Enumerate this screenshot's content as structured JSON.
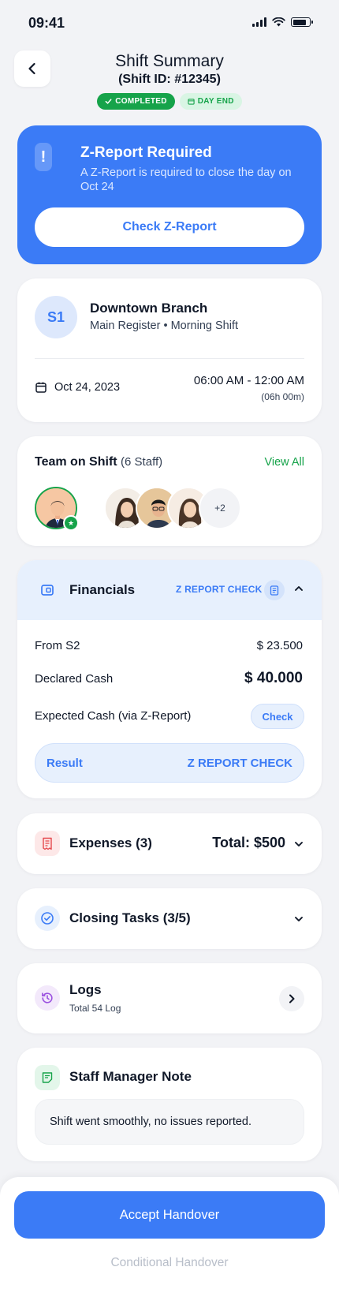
{
  "status_bar": {
    "time": "09:41"
  },
  "header": {
    "title": "Shift Summary",
    "subtitle": "(Shift ID: #12345)",
    "badge_completed": "COMPLETED",
    "badge_day_end": "DAY END"
  },
  "z_report_banner": {
    "title": "Z-Report Required",
    "description": "A Z-Report is required to close the day on Oct 24",
    "button_label": "Check Z-Report"
  },
  "branch": {
    "avatar_initials": "S1",
    "name": "Downtown Branch",
    "details": "Main Register • Morning Shift",
    "date": "Oct 24, 2023",
    "time_range": "06:00 AM - 12:00 AM",
    "duration": "(06h 00m)"
  },
  "team": {
    "title": "Team on Shift",
    "count": "(6 Staff)",
    "view_all": "View All",
    "more_count": "+2"
  },
  "financials": {
    "title": "Financials",
    "tag": "Z REPORT CHECK",
    "rows": [
      {
        "label": "From S2",
        "value": "$ 23.500"
      },
      {
        "label": "Declared Cash",
        "value": "$ 40.000"
      },
      {
        "label": "Expected Cash (via Z-Report)",
        "action": "Check"
      }
    ],
    "result_label": "Result",
    "result_value": "Z REPORT CHECK"
  },
  "expenses": {
    "title": "Expenses (3)",
    "total": "Total: $500"
  },
  "closing_tasks": {
    "title": "Closing Tasks (3/5)"
  },
  "logs": {
    "title": "Logs",
    "subtitle": "Total 54 Log"
  },
  "note": {
    "title": "Staff Manager Note",
    "text": "Shift went smoothly, no issues reported."
  },
  "actions": {
    "accept": "Accept Handover",
    "conditional": "Conditional Handover"
  },
  "colors": {
    "primary": "#3b7bf6",
    "success": "#16a34a",
    "background": "#f2f3f6",
    "danger": "#e5484d",
    "purple": "#9b51e0"
  }
}
